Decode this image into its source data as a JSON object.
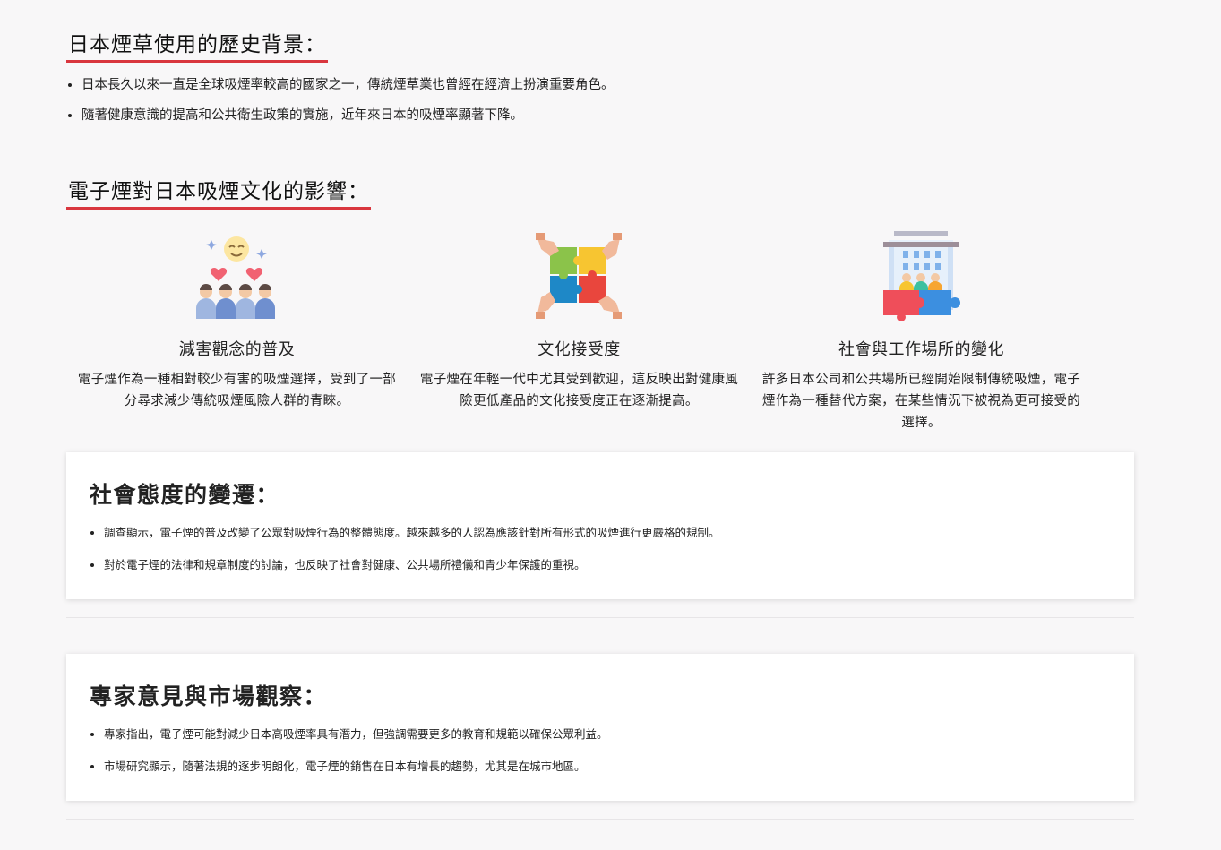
{
  "history": {
    "heading": "日本煙草使用的歷史背景：",
    "items": [
      "日本長久以來一直是全球吸煙率較高的國家之一，傳統煙草業也曾經在經濟上扮演重要角色。",
      "隨著健康意識的提高和公共衛生政策的實施，近年來日本的吸煙率顯著下降。"
    ]
  },
  "impact": {
    "heading": "電子煙對日本吸煙文化的影響：",
    "features": [
      {
        "icon": "happy-people-hearts-icon",
        "title": "減害觀念的普及",
        "description": "電子煙作為一種相對較少有害的吸煙選擇，受到了一部分尋求減少傳統吸煙風險人群的青睞。"
      },
      {
        "icon": "puzzle-hands-icon",
        "title": "文化接受度",
        "description": "電子煙在年輕一代中尤其受到歡迎，這反映出對健康風險更低產品的文化接受度正在逐漸提高。"
      },
      {
        "icon": "workplace-puzzle-icon",
        "title": "社會與工作場所的變化",
        "description": "許多日本公司和公共場所已經開始限制傳統吸煙，電子煙作為一種替代方案，在某些情況下被視為更可接受的選擇。"
      }
    ]
  },
  "social": {
    "heading": "社會態度的變遷：",
    "items": [
      "調查顯示，電子煙的普及改變了公眾對吸煙行為的整體態度。越來越多的人認為應該針對所有形式的吸煙進行更嚴格的規制。",
      "對於電子煙的法律和規章制度的討論，也反映了社會對健康、公共場所禮儀和青少年保護的重視。"
    ]
  },
  "expert": {
    "heading": "專家意見與市場觀察：",
    "items": [
      "專家指出，電子煙可能對減少日本高吸煙率具有潛力，但強調需要更多的教育和規範以確保公眾利益。",
      "市場研究顯示，隨著法規的逐步明朗化，電子煙的銷售在日本有增長的趨勢，尤其是在城市地區。"
    ]
  },
  "colors": {
    "accent_underline": "#d9363e",
    "page_background": "#f8f7f8",
    "card_background": "#ffffff"
  }
}
